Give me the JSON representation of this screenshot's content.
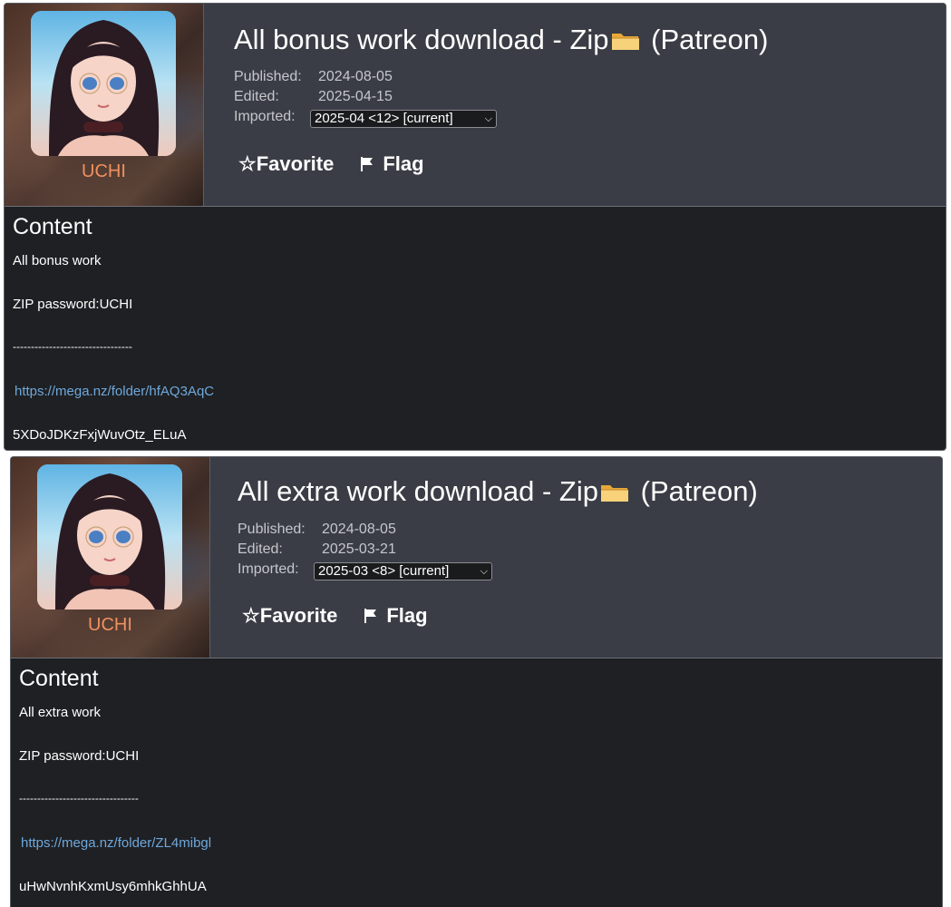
{
  "posts": [
    {
      "artist": "UCHI",
      "title": "All bonus work download - Zip",
      "title_suffix": "(Patreon)",
      "published_label": "Published:",
      "published": "2024-08-05",
      "edited_label": "Edited:",
      "edited": "2025-04-15",
      "imported_label": "Imported:",
      "imported": "2025-04 <12> [current]",
      "favorite_label": "☆Favorite",
      "flag_label": "Flag",
      "content_heading": "Content",
      "lines": [
        "All bonus work",
        "ZIP password:UCHI",
        "---------------------------------"
      ],
      "link": "https://mega.nz/folder/hfAQ3AqC",
      "key": "5XDoJDKzFxjWuvOtz_ELuA"
    },
    {
      "artist": "UCHI",
      "title": "All extra work download - Zip",
      "title_suffix": "(Patreon)",
      "published_label": "Published:",
      "published": "2024-08-05",
      "edited_label": "Edited:",
      "edited": "2025-03-21",
      "imported_label": "Imported:",
      "imported": "2025-03 <8> [current]",
      "favorite_label": "☆Favorite",
      "flag_label": "Flag",
      "content_heading": "Content",
      "lines": [
        "All extra work",
        "ZIP password:UCHI",
        "---------------------------------"
      ],
      "link": "https://mega.nz/folder/ZL4mibgl",
      "key": "uHwNvnhKxmUsy6mhkGhhUA"
    }
  ],
  "icons": {
    "folder": "folder-icon",
    "flag": "flag-icon",
    "dropdown": "chevron-down-icon"
  },
  "colors": {
    "artist": "#f0915f",
    "link": "#6ea8dc",
    "header_bg": "#3a3d45",
    "content_bg": "#1f2023"
  }
}
